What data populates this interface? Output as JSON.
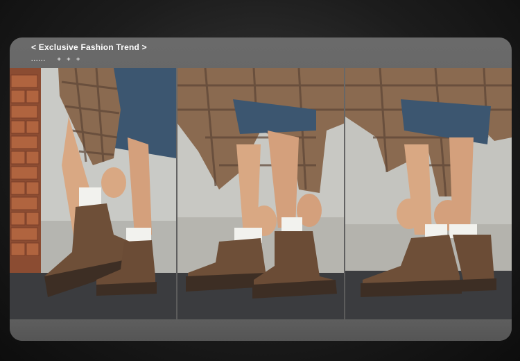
{
  "banner": {
    "title": "< Exclusive Fashion Trend >",
    "ornament_dots": "......",
    "ornament_plus": "+ + +"
  },
  "photos": [
    {
      "name": "photo-panel-1",
      "scene": "lacing-boot-brick-wall"
    },
    {
      "name": "photo-panel-2",
      "scene": "tying-boot-laces-standing"
    },
    {
      "name": "photo-panel-3",
      "scene": "lacing-boot-side-view"
    }
  ],
  "colors": {
    "background": "#1c1c1c",
    "card": "#666666",
    "boot": "#6e4f38",
    "sole": "#3d2e24",
    "plaid": "#8a6a50",
    "denim": "#3c5670",
    "pavement": "#3b3c3f"
  }
}
